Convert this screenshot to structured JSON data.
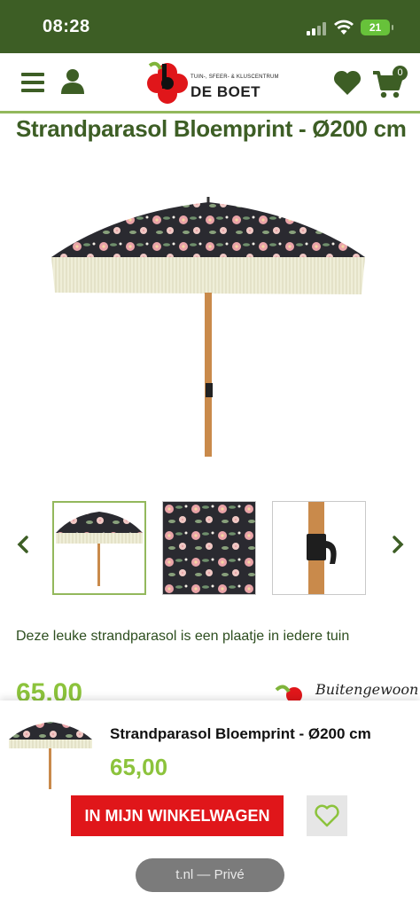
{
  "status_bar": {
    "time": "08:28",
    "battery": "21"
  },
  "header": {
    "logo_tagline": "TUIN-, SFEER- & KLUSCENTRUM",
    "logo_name": "DE BOET",
    "cart_count": "0"
  },
  "product": {
    "title": "Strandparasol Bloemprint - Ø200 cm",
    "description": "Deze leuke strandparasol is een plaatje in iedere tuin",
    "price": "65,00",
    "brand_slogan": "Buitengewoon"
  },
  "sticky_bar": {
    "title": "Strandparasol Bloemprint - Ø200 cm",
    "price": "65,00",
    "add_to_cart_label": "IN MIJN WINKELWAGEN"
  },
  "browser": {
    "url_label": "t.nl — Privé"
  },
  "colors": {
    "brand_green": "#3d5e25",
    "accent_green": "#8cc33c",
    "border_green": "#93b85c",
    "cta_red": "#e0161a"
  },
  "icons": {
    "menu": "hamburger-icon",
    "account": "user-icon",
    "wishlist": "heart-icon",
    "cart": "cart-icon",
    "prev": "chevron-left-icon",
    "next": "chevron-right-icon"
  }
}
